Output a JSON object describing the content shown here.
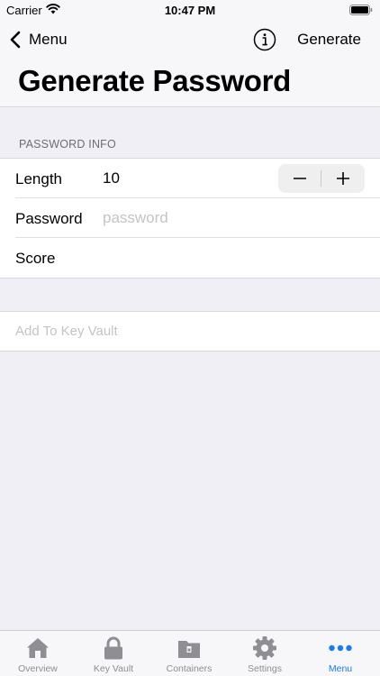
{
  "status_bar": {
    "carrier": "Carrier",
    "time": "10:47 PM"
  },
  "nav": {
    "back_label": "Menu",
    "generate_label": "Generate"
  },
  "page": {
    "title": "Generate Password"
  },
  "section": {
    "header": "PASSWORD INFO"
  },
  "form": {
    "length_label": "Length",
    "length_value": "10",
    "password_label": "Password",
    "password_placeholder": "password",
    "score_label": "Score"
  },
  "action": {
    "add_label": "Add To Key Vault"
  },
  "tabs": [
    {
      "label": "Overview",
      "icon": "house-icon",
      "active": false
    },
    {
      "label": "Key Vault",
      "icon": "lock-icon",
      "active": false
    },
    {
      "label": "Containers",
      "icon": "folder-icon",
      "active": false
    },
    {
      "label": "Settings",
      "icon": "gear-icon",
      "active": false
    },
    {
      "label": "Menu",
      "icon": "more-icon",
      "active": true
    }
  ],
  "colors": {
    "accent": "#1a7cf0",
    "tab_inactive": "#8e8e93",
    "placeholder": "#c4c4c7"
  }
}
